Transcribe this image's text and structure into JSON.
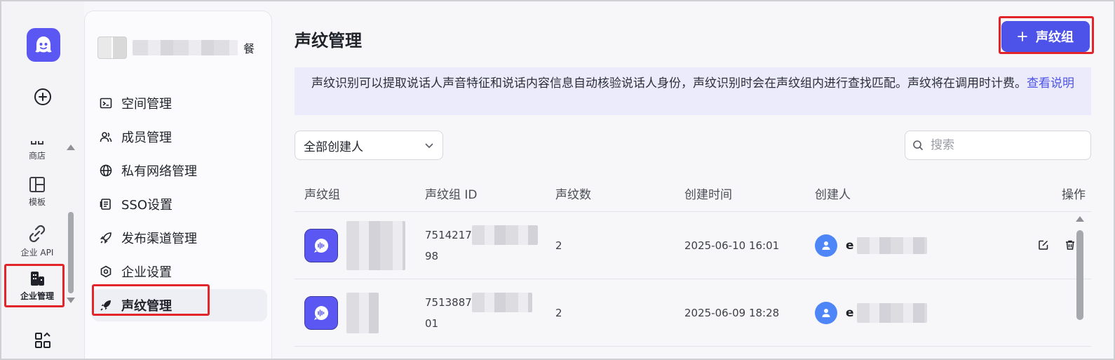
{
  "rail": {
    "items": [
      {
        "label": "商店",
        "icon": "store-icon"
      },
      {
        "label": "模板",
        "icon": "template-icon"
      },
      {
        "label": "企业 API",
        "icon": "api-link-icon"
      },
      {
        "label": "企业管理",
        "icon": "enterprise-building-icon"
      }
    ]
  },
  "sidebar": {
    "team_suffix": "餐",
    "items": [
      {
        "label": "空间管理",
        "icon": "terminal-folder-icon"
      },
      {
        "label": "成员管理",
        "icon": "members-icon"
      },
      {
        "label": "私有网络管理",
        "icon": "globe-icon"
      },
      {
        "label": "SSO设置",
        "icon": "sso-doc-icon"
      },
      {
        "label": "发布渠道管理",
        "icon": "rocket-icon"
      },
      {
        "label": "企业设置",
        "icon": "gear-icon"
      },
      {
        "label": "声纹管理",
        "icon": "rocket-icon"
      }
    ]
  },
  "main": {
    "title": "声纹管理",
    "add_button": "声纹组",
    "notice_text": "声纹识别可以提取说话人声音特征和说话内容信息自动核验说话人身份，声纹识别时会在声纹组内进行查找匹配。声纹将在调用时计费。",
    "notice_link": "查看说明",
    "filter_value": "全部创建人",
    "search_placeholder": "搜索",
    "columns": [
      "声纹组",
      "声纹组 ID",
      "声纹数",
      "创建时间",
      "创建人",
      "操作"
    ],
    "rows": [
      {
        "id_prefix": "7514217",
        "id_suffix": "98",
        "count": "2",
        "created": "2025-06-10 16:01",
        "creator_initial": "e"
      },
      {
        "id_prefix": "7513887",
        "id_suffix": "01",
        "count": "2",
        "created": "2025-06-09 18:28",
        "creator_initial": "e"
      }
    ]
  },
  "colors": {
    "accent": "#4d53e8",
    "logo": "#5b57f2",
    "highlight_box": "#e2252b",
    "notice_bg": "#ebebfc",
    "avatar": "#4f86f7"
  }
}
